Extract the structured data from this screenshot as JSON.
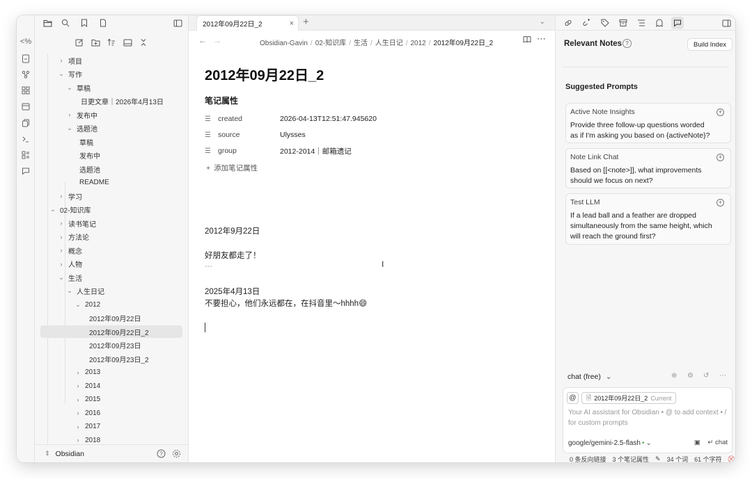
{
  "ribbon": {
    "items": [
      {
        "icon": "embed-code-icon",
        "glyph": "<%"
      },
      {
        "icon": "note-icon"
      },
      {
        "icon": "graph-icon"
      },
      {
        "icon": "canvas-icon"
      },
      {
        "icon": "calendar-icon"
      },
      {
        "icon": "copy-icon"
      },
      {
        "icon": "terminal-icon"
      },
      {
        "icon": "templates-icon"
      },
      {
        "icon": "chat-icon"
      }
    ]
  },
  "sidebar": {
    "vault_name": "Obsidian",
    "tree": [
      {
        "label": "项目",
        "level": 1,
        "chev": "›"
      },
      {
        "label": "写作",
        "level": 1,
        "chev": "⌄"
      },
      {
        "label": "草稿",
        "level": 2,
        "chev": "⌄"
      },
      {
        "label": "日更文章｜2026年4月13日",
        "level": 3,
        "chev": ""
      },
      {
        "label": "发布中",
        "level": 2,
        "chev": "›"
      },
      {
        "label": "选题池",
        "level": 2,
        "chev": "⌄"
      },
      {
        "label": "草稿",
        "level": 2,
        "chev": "",
        "indent": 1
      },
      {
        "label": "发布中",
        "level": 2,
        "chev": "",
        "indent": 1
      },
      {
        "label": "选题池",
        "level": 2,
        "chev": "",
        "indent": 1
      },
      {
        "label": "README",
        "level": 2,
        "chev": "",
        "indent": 1
      },
      {
        "label": "学习",
        "level": 1,
        "chev": "›"
      },
      {
        "label": "02-知识库",
        "level": 0,
        "chev": "⌄"
      },
      {
        "label": "读书笔记",
        "level": 1,
        "chev": "›"
      },
      {
        "label": "方法论",
        "level": 1,
        "chev": "›"
      },
      {
        "label": "概念",
        "level": 1,
        "chev": "›"
      },
      {
        "label": "人物",
        "level": 1,
        "chev": "›"
      },
      {
        "label": "生活",
        "level": 1,
        "chev": "⌄"
      },
      {
        "label": "人生日记",
        "level": 2,
        "chev": "⌄"
      },
      {
        "label": "2012",
        "level": 3,
        "chev": "⌄"
      },
      {
        "label": "2012年09月22日",
        "level": 4,
        "chev": ""
      },
      {
        "label": "2012年09月22日_2",
        "level": 4,
        "chev": "",
        "active": true
      },
      {
        "label": "2012年09月23日",
        "level": 4,
        "chev": ""
      },
      {
        "label": "2012年09月23日_2",
        "level": 4,
        "chev": ""
      },
      {
        "label": "2013",
        "level": 3,
        "chev": "›"
      },
      {
        "label": "2014",
        "level": 3,
        "chev": "›"
      },
      {
        "label": "2015",
        "level": 3,
        "chev": "›"
      },
      {
        "label": "2016",
        "level": 3,
        "chev": "›"
      },
      {
        "label": "2017",
        "level": 3,
        "chev": "›"
      },
      {
        "label": "2018",
        "level": 3,
        "chev": "›"
      }
    ]
  },
  "tab": {
    "title": "2012年09月22日_2",
    "close": "×",
    "new": "+"
  },
  "breadcrumb": {
    "parts": [
      "Obsidian-Gavin",
      "02-知识库",
      "生活",
      "人生日记",
      "2012"
    ],
    "current": "2012年09月22日_2"
  },
  "note": {
    "title": "2012年09月22日_2",
    "properties_heading": "笔记属性",
    "properties": [
      {
        "key": "created",
        "value": "2026-04-13T12:51:47.945620"
      },
      {
        "key": "source",
        "value": "Ulysses"
      },
      {
        "key": "group",
        "value": "2012-2014｜邮箱遗记"
      }
    ],
    "add_property": "添加笔记属性",
    "lines": [
      {
        "text": "2012年9月22日"
      },
      {
        "text": " 好朋友都走了！"
      },
      {
        "text": "---",
        "muted": true
      },
      {
        "text": "2025年4月13日"
      },
      {
        "text": "不要担心，他们永远都在，在抖音里～hhhh😄"
      }
    ]
  },
  "right_panel": {
    "relevant_title": "Relevant Notes",
    "build_index": "Build Index",
    "suggested_title": "Suggested Prompts",
    "prompts": [
      {
        "title": "Active Note Insights",
        "body": "Provide three follow-up questions worded as if I'm asking you based on {activeNote}?"
      },
      {
        "title": "Note Link Chat",
        "body": "Based on [[<note>]], what improvements should we focus on next?"
      },
      {
        "title": "Test LLM",
        "body": "If a lead ball and a feather are dropped simultaneously from the same height, which will reach the ground first?"
      }
    ],
    "chat_mode": "chat (free)",
    "at_symbol": "@",
    "context_chip": "2012年09月22日_2",
    "context_current": "Current",
    "input_placeholder": "Your AI assistant for Obsidian • @ to add context • / for custom prompts",
    "model": "google/gemini-2.5-flash",
    "send_label": "chat"
  },
  "status": {
    "backlinks": "0 条反向链接",
    "properties": "3 个笔记属性",
    "words": "34 个词",
    "chars": "61 个字符"
  }
}
